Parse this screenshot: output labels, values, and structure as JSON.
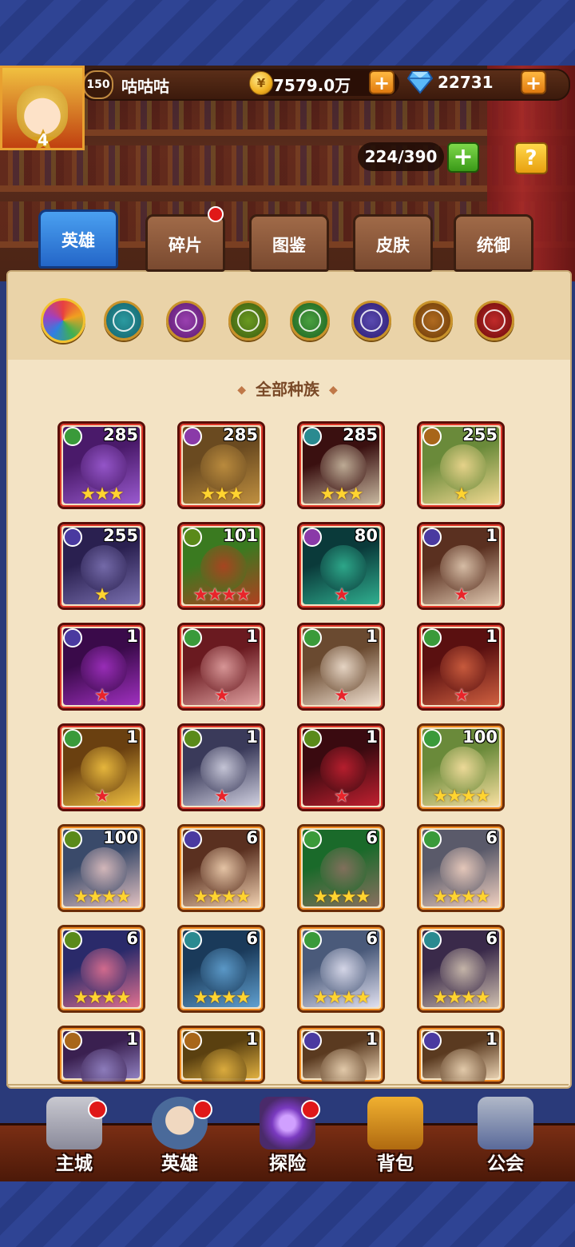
{
  "player": {
    "level": "150",
    "name": "咕咕咕",
    "avatar_star": "4"
  },
  "currency": {
    "gold": "7579.0万",
    "gold_icon": "gold-coin-icon",
    "gems": "22731",
    "gem_icon": "diamond-icon"
  },
  "plus_symbol": "+",
  "capacity": "224/390",
  "help_symbol": "?",
  "tabs": [
    {
      "label": "英雄",
      "active": true
    },
    {
      "label": "碎片",
      "badge": true
    },
    {
      "label": "图鉴"
    },
    {
      "label": "皮肤"
    },
    {
      "label": "统御"
    }
  ],
  "race_filters": [
    "all-races-icon",
    "forest-race-icon",
    "shadow-race-icon",
    "fortress-race-icon",
    "nature-race-icon",
    "abyss-race-icon",
    "light-race-icon",
    "dark-race-icon"
  ],
  "race_title": "全部种族",
  "race_title_deco": "◆",
  "colors": {
    "accent_blue": "#2466c8",
    "red_star": "#e8242a",
    "gold_star": "#ffd430",
    "parchment": "#f3e3c4"
  },
  "heroes": [
    {
      "level": "285",
      "stars": "★★★",
      "star_color": "gold",
      "frame": "red",
      "race": "nature",
      "palette": [
        "#4a1a6a",
        "#9a5ad0"
      ]
    },
    {
      "level": "285",
      "stars": "★★★",
      "star_color": "gold",
      "frame": "red",
      "race": "shadow",
      "palette": [
        "#6a4a20",
        "#c09040"
      ]
    },
    {
      "level": "285",
      "stars": "★★★",
      "star_color": "gold",
      "frame": "red",
      "race": "forest",
      "palette": [
        "#3a1010",
        "#c8b8a0"
      ]
    },
    {
      "level": "255",
      "stars": "★",
      "star_color": "gold",
      "frame": "red",
      "race": "light",
      "palette": [
        "#6a8a3a",
        "#f0d890"
      ]
    },
    {
      "level": "255",
      "stars": "★",
      "star_color": "gold",
      "frame": "red",
      "race": "abyss",
      "palette": [
        "#2a2050",
        "#7a70b0"
      ]
    },
    {
      "level": "101",
      "stars": "★★★★",
      "star_color": "red",
      "frame": "red",
      "race": "fortress",
      "palette": [
        "#3a7a20",
        "#b04020"
      ]
    },
    {
      "level": "80",
      "stars": "★",
      "star_color": "red",
      "frame": "red",
      "race": "shadow",
      "palette": [
        "#0a3a3a",
        "#30b090"
      ]
    },
    {
      "level": "1",
      "stars": "★",
      "star_color": "red",
      "frame": "red",
      "race": "abyss",
      "palette": [
        "#5a3020",
        "#e0c8b0"
      ]
    },
    {
      "level": "1",
      "stars": "★",
      "star_color": "red",
      "frame": "red",
      "race": "abyss",
      "palette": [
        "#3a0a4a",
        "#a030c0"
      ]
    },
    {
      "level": "1",
      "stars": "★",
      "star_color": "red",
      "frame": "red",
      "race": "nature",
      "palette": [
        "#6a1a20",
        "#e0a0a0"
      ]
    },
    {
      "level": "1",
      "stars": "★",
      "star_color": "red",
      "frame": "red",
      "race": "nature",
      "palette": [
        "#6a4a30",
        "#f0e0d0"
      ]
    },
    {
      "level": "1",
      "stars": "★",
      "star_color": "red",
      "frame": "red",
      "race": "nature",
      "palette": [
        "#5a1010",
        "#d06040"
      ]
    },
    {
      "level": "1",
      "stars": "★",
      "star_color": "red",
      "frame": "red",
      "race": "nature",
      "palette": [
        "#6a4010",
        "#f0c040"
      ]
    },
    {
      "level": "1",
      "stars": "★",
      "star_color": "red",
      "frame": "red",
      "race": "fortress",
      "palette": [
        "#3a3a5a",
        "#d0d0e0"
      ]
    },
    {
      "level": "1",
      "stars": "★",
      "star_color": "red",
      "frame": "red",
      "race": "fortress",
      "palette": [
        "#3a0a10",
        "#c02030"
      ]
    },
    {
      "level": "100",
      "stars": "★★★★",
      "star_color": "gold",
      "frame": "orange",
      "race": "nature",
      "palette": [
        "#6a8a3a",
        "#f8e0a0"
      ]
    },
    {
      "level": "100",
      "stars": "★★★★",
      "star_color": "gold",
      "frame": "orange",
      "race": "fortress",
      "palette": [
        "#3a4a6a",
        "#e0c0c0"
      ]
    },
    {
      "level": "6",
      "stars": "★★★★",
      "star_color": "gold",
      "frame": "orange",
      "race": "abyss",
      "palette": [
        "#5a3020",
        "#f0d0b0"
      ]
    },
    {
      "level": "6",
      "stars": "★★★★",
      "star_color": "gold",
      "frame": "orange",
      "race": "nature",
      "palette": [
        "#1a6a2a",
        "#8a7060"
      ]
    },
    {
      "level": "6",
      "stars": "★★★★",
      "star_color": "gold",
      "frame": "orange",
      "race": "nature",
      "palette": [
        "#5a5a6a",
        "#f0d0c0"
      ]
    },
    {
      "level": "6",
      "stars": "★★★★",
      "star_color": "gold",
      "frame": "orange",
      "race": "fortress",
      "palette": [
        "#2a2a6a",
        "#e07090"
      ]
    },
    {
      "level": "6",
      "stars": "★★★★",
      "star_color": "gold",
      "frame": "orange",
      "race": "forest",
      "palette": [
        "#1a3a5a",
        "#60a0d0"
      ]
    },
    {
      "level": "6",
      "stars": "★★★★",
      "star_color": "gold",
      "frame": "orange",
      "race": "nature",
      "palette": [
        "#4a5a7a",
        "#e0e0f0"
      ]
    },
    {
      "level": "6",
      "stars": "★★★★",
      "star_color": "gold",
      "frame": "orange",
      "race": "forest",
      "palette": [
        "#3a2a4a",
        "#d0c0b0"
      ]
    },
    {
      "level": "1",
      "stars": "",
      "star_color": "gold",
      "frame": "orange",
      "race": "light",
      "palette": [
        "#3a2050",
        "#9080c0"
      ]
    },
    {
      "level": "1",
      "stars": "",
      "star_color": "gold",
      "frame": "orange",
      "race": "light",
      "palette": [
        "#5a4010",
        "#e0b040"
      ]
    },
    {
      "level": "1",
      "stars": "",
      "star_color": "gold",
      "frame": "orange",
      "race": "abyss",
      "palette": [
        "#5a3a20",
        "#e8d0b0"
      ]
    },
    {
      "level": "1",
      "stars": "",
      "star_color": "gold",
      "frame": "orange",
      "race": "abyss",
      "palette": [
        "#5a3a20",
        "#e8d0b0"
      ]
    }
  ],
  "nav": [
    {
      "label": "主城",
      "icon": "castle-icon",
      "badge": true
    },
    {
      "label": "英雄",
      "icon": "hero-portrait-icon",
      "badge": true
    },
    {
      "label": "探险",
      "icon": "portal-icon",
      "badge": true
    },
    {
      "label": "背包",
      "icon": "backpack-icon",
      "badge": false
    },
    {
      "label": "公会",
      "icon": "guild-tower-icon",
      "badge": false
    }
  ]
}
